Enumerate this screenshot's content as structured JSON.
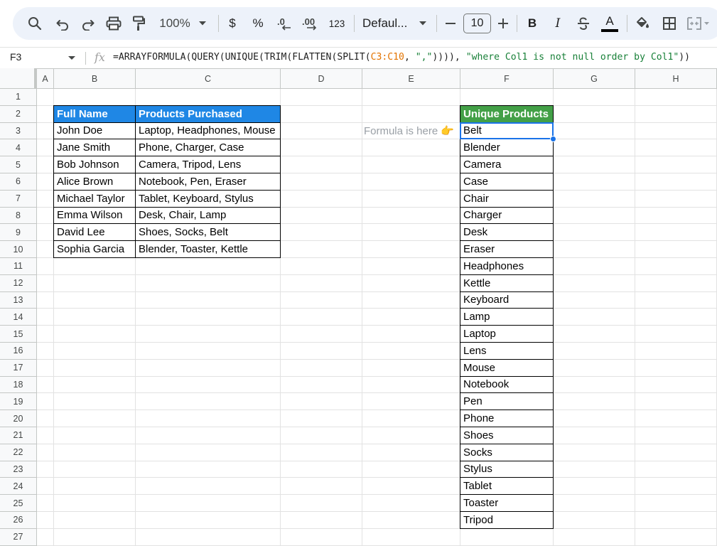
{
  "toolbar": {
    "zoom": "100%",
    "currency_label": "$",
    "percent_label": "%",
    "decrease_decimal_label": ".0",
    "increase_decimal_label": ".00",
    "number_format_label": "123",
    "font_name": "Defaul...",
    "font_size": "10",
    "bold_label": "B",
    "italic_label": "I",
    "text_color_label": "A",
    "minus_label": "—",
    "plus_label": "+"
  },
  "formula_bar": {
    "cell_ref": "F3",
    "fx": "fx",
    "formula_part1": "=ARRAYFORMULA(QUERY(UNIQUE(TRIM(FLATTEN(SPLIT(",
    "formula_range": "C3:C10",
    "formula_part2": ", ",
    "formula_str1": "\",\"",
    "formula_part3": ")))), ",
    "formula_str2": "\"where Col1 is not null order by Col1\"",
    "formula_part4": "))"
  },
  "columns": [
    "A",
    "B",
    "C",
    "D",
    "E",
    "F",
    "G",
    "H"
  ],
  "rows": [
    "1",
    "2",
    "3",
    "4",
    "5",
    "6",
    "7",
    "8",
    "9",
    "10",
    "11",
    "12",
    "13",
    "14",
    "15",
    "16",
    "17",
    "18",
    "19",
    "20",
    "21",
    "22",
    "23",
    "24",
    "25",
    "26",
    "27"
  ],
  "table": {
    "headers": [
      "Full Name",
      "Products Purchased"
    ],
    "rows": [
      [
        "John Doe",
        "Laptop, Headphones, Mouse"
      ],
      [
        "Jane Smith",
        "Phone, Charger, Case"
      ],
      [
        "Bob Johnson",
        "Camera, Tripod, Lens"
      ],
      [
        "Alice Brown",
        "Notebook, Pen, Eraser"
      ],
      [
        "Michael Taylor",
        "Tablet, Keyboard, Stylus"
      ],
      [
        "Emma Wilson",
        "Desk, Chair, Lamp"
      ],
      [
        "David Lee",
        "Shoes, Socks, Belt"
      ],
      [
        "Sophia Garcia",
        "Blender, Toaster, Kettle"
      ]
    ]
  },
  "note": "Formula is here 👉",
  "unique": {
    "header": "Unique Products",
    "items": [
      "Belt",
      "Blender",
      "Camera",
      "Case",
      "Chair",
      "Charger",
      "Desk",
      "Eraser",
      "Headphones",
      "Kettle",
      "Keyboard",
      "Lamp",
      "Laptop",
      "Lens",
      "Mouse",
      "Notebook",
      "Pen",
      "Phone",
      "Shoes",
      "Socks",
      "Stylus",
      "Tablet",
      "Toaster",
      "Tripod"
    ]
  },
  "colors": {
    "blue_header": "#1f87e5",
    "green_header": "#43a047",
    "selection": "#1a73e8",
    "formula_range": "#e37400",
    "formula_string": "#188038"
  }
}
